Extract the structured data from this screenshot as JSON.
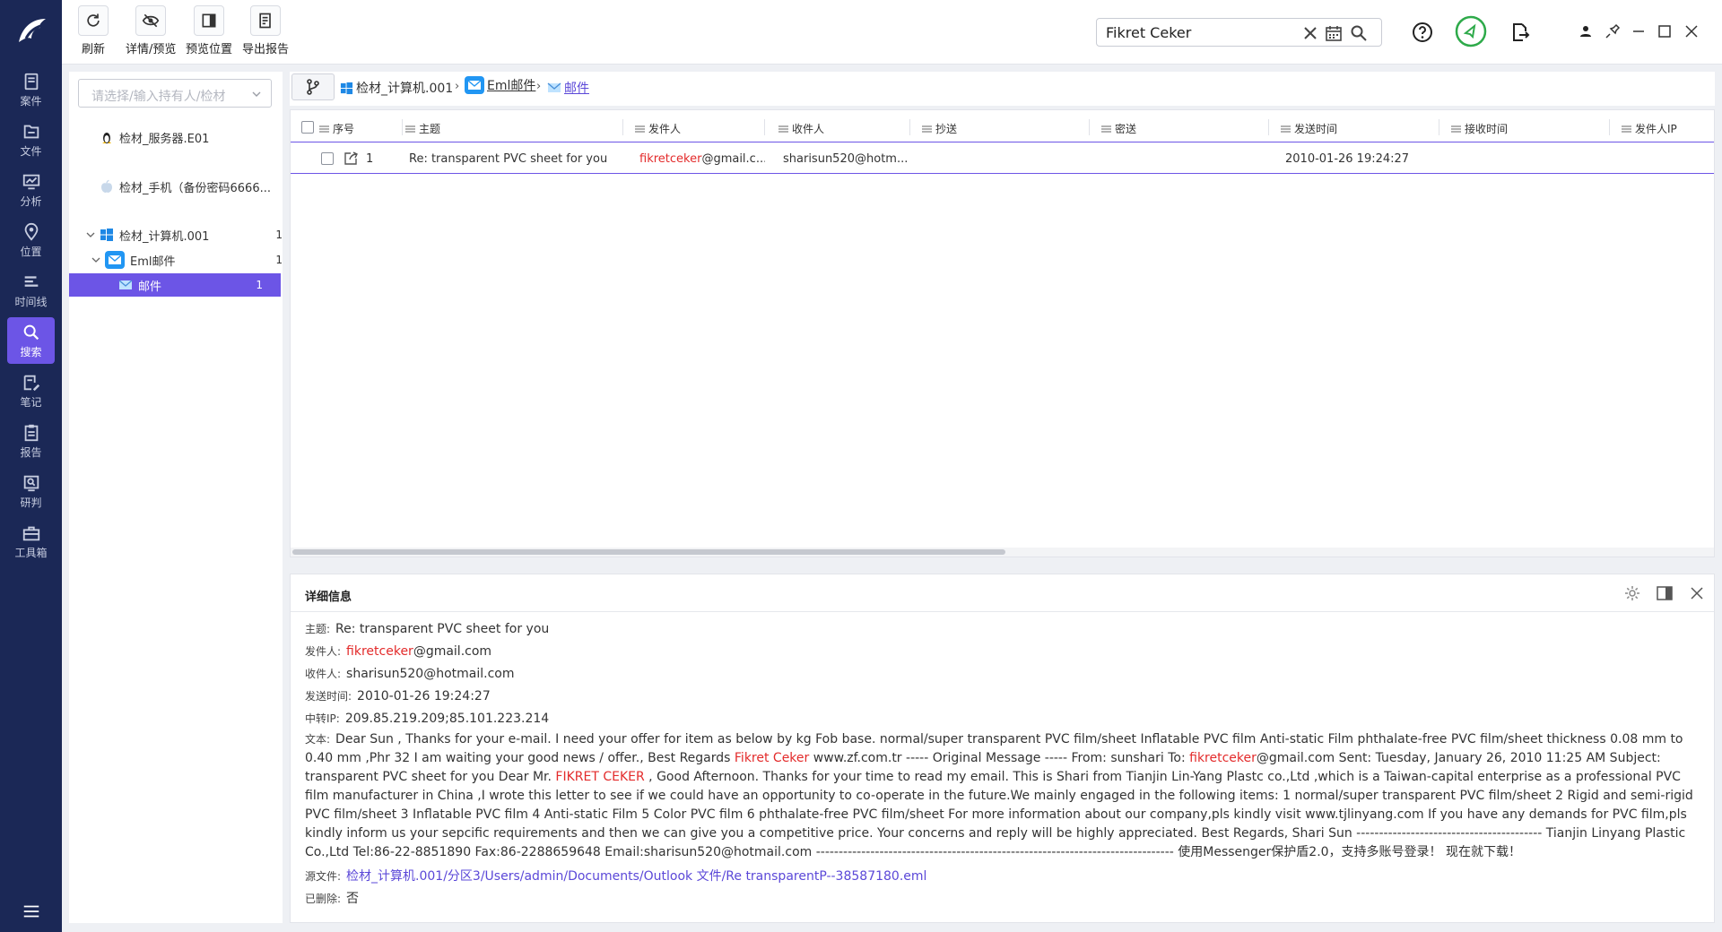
{
  "rail": {
    "items": [
      {
        "label": "案件",
        "icon": "case-icon"
      },
      {
        "label": "文件",
        "icon": "file-icon"
      },
      {
        "label": "分析",
        "icon": "analysis-icon"
      },
      {
        "label": "位置",
        "icon": "location-icon"
      },
      {
        "label": "时间线",
        "icon": "timeline-icon"
      },
      {
        "label": "搜索",
        "icon": "search-icon",
        "active": true
      },
      {
        "label": "笔记",
        "icon": "note-icon"
      },
      {
        "label": "报告",
        "icon": "report-icon"
      },
      {
        "label": "研判",
        "icon": "judge-icon"
      },
      {
        "label": "工具箱",
        "icon": "toolbox-icon"
      }
    ]
  },
  "toolbar": {
    "refresh_label": "刷新",
    "detail_preview_label": "详情/预览",
    "preview_position_label": "预览位置",
    "export_report_label": "导出报告"
  },
  "search": {
    "value": "Fikret Ceker"
  },
  "left": {
    "dropdown_placeholder": "请选择/输入持有人/检材",
    "tree": [
      {
        "label": "检材_服务器.E01",
        "icon": "linux-icon"
      },
      {
        "label": "检材_手机（备份密码6666...",
        "icon": "apple-icon"
      },
      {
        "label": "检材_计算机.001",
        "count": "1",
        "icon": "windows-icon"
      },
      {
        "label": "Eml邮件",
        "count": "1",
        "icon": "mail-icon"
      },
      {
        "label": "邮件",
        "count": "1",
        "icon": "envelope-icon",
        "selected": true
      }
    ]
  },
  "breadcrumb": {
    "items": [
      "检材_计算机.001",
      "Eml邮件",
      "邮件"
    ]
  },
  "table": {
    "columns": [
      "序号",
      "主题",
      "发件人",
      "收件人",
      "抄送",
      "密送",
      "发送时间",
      "接收时间",
      "发件人IP"
    ],
    "rows": [
      {
        "index": "1",
        "subject": "Re: transparent PVC sheet for you",
        "sender_highlight": "fikretceker",
        "sender_rest": "@gmail.c...",
        "recipient": "sharisun520@hotm...",
        "cc": "",
        "bcc": "",
        "sent_time": "2010-01-26 19:24:27",
        "recv_time": "",
        "sender_ip": ""
      }
    ]
  },
  "detail": {
    "title": "详细信息",
    "subject_label": "主题:",
    "subject": "Re: transparent PVC sheet for you",
    "sender_label": "发件人:",
    "sender_highlight": "fikretceker",
    "sender_rest": "@gmail.com",
    "recipient_label": "收件人:",
    "recipient": "sharisun520@hotmail.com",
    "sent_label": "发送时间:",
    "sent_time": "2010-01-26 19:24:27",
    "relay_label": "中转IP:",
    "relay_ip": "209.85.219.209;85.101.223.214",
    "text_label": "文本:",
    "text_1": "Dear Sun , Thanks for your e-mail. I need your offer for item as below by kg Fob base. normal/super transparent PVC film/sheet Inflatable PVC film Anti-static Film phthalate-free PVC film/sheet thickness 0.08 mm to 0.40 mm ,Phr 32 I am waiting your good news / offer., Best Regards ",
    "text_hl_1": "Fikret Ceker",
    "text_2": " www.zf.com.tr ----- Original Message ----- From: sunshari To: ",
    "text_hl_2": "fikretceker",
    "text_3": "@gmail.com Sent: Tuesday, January 26, 2010 11:25 AM Subject: transparent PVC sheet for you Dear Mr. ",
    "text_hl_3": "FIKRET CEKER",
    "text_4": " , Good Afternoon. Thanks for your time to read my email. This is Shari from Tianjin Lin-Yang Plastc co.,Ltd ,which is a Taiwan-capital enterprise as a professional PVC film manufacturer in China ,I wrote this letter to see if we could have an opportunity to co-operate in the future.We mainly engaged in the following items: 1 normal/super transparent PVC film/sheet 2 Rigid and semi-rigid PVC film/sheet 3 Inflatable PVC film 4 Anti-static Film 5 Color PVC film 6 phthalate-free PVC film/sheet For more information about our company,pls kindly visit www.tjlinyang.com If you have any demands for PVC film,pls kindly inform us your sepcific requirements and then we can give you a competitive price. Your concerns and reply will be highly appreciated. Best Regards, Shari Sun ----------------------------------------- Tianjin Linyang Plastic Co.,Ltd Tel:86-22-8851890 Fax:86-2288659648 Email:sharisun520@hotmail.com ------------------------------------------------------------------------------- 使用Messenger保护盾2.0，支持多账号登录！ 现在就下载！",
    "source_label": "源文件:",
    "source_path": "检材_计算机.001/分区3/Users/admin/Documents/Outlook 文件/Re transparentP--38587180.eml",
    "deleted_label": "已删除:",
    "deleted": "否"
  },
  "colors": {
    "accent": "#6c55e6",
    "rail": "#1b2856",
    "highlight": "#e32b2b",
    "green": "#2eaa4a"
  }
}
